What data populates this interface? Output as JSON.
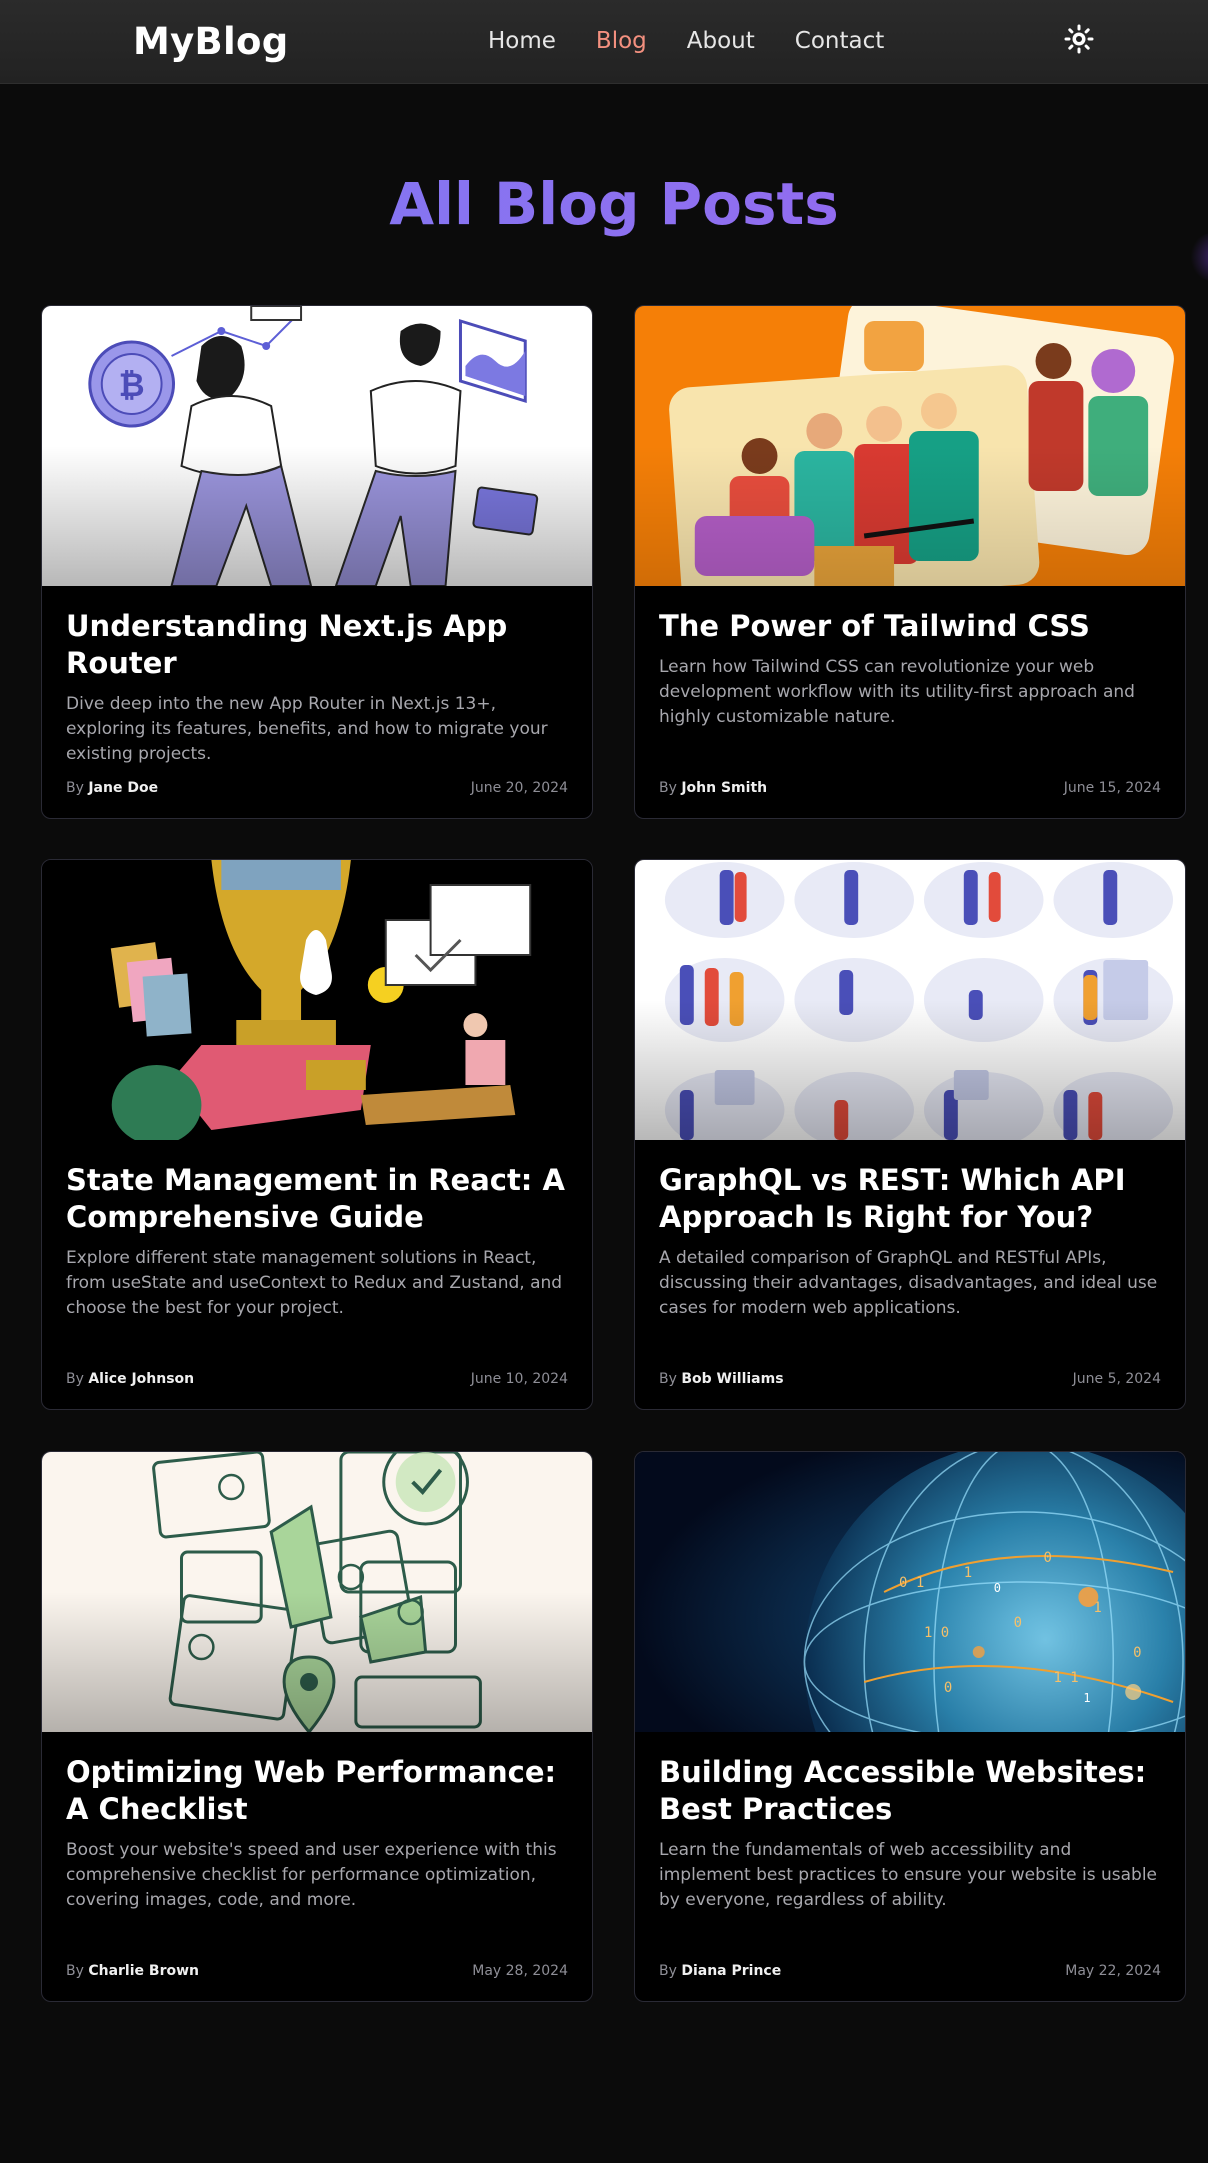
{
  "header": {
    "logo": "MyBlog",
    "nav": [
      "Home",
      "Blog",
      "About",
      "Contact"
    ],
    "active_nav": "Blog",
    "theme_icon": "sun-icon"
  },
  "page": {
    "title": "All Blog Posts"
  },
  "posts": [
    {
      "title": "Understanding Next.js App Router",
      "description": "Dive deep into the new App Router in Next.js 13+, exploring its features, benefits, and how to migrate your existing projects.",
      "by": "By",
      "author": "Jane Doe",
      "date": "June 20, 2024"
    },
    {
      "title": "The Power of Tailwind CSS",
      "description": "Learn how Tailwind CSS can revolutionize your web development workflow with its utility-first approach and highly customizable nature.",
      "by": "By",
      "author": "John Smith",
      "date": "June 15, 2024"
    },
    {
      "title": "State Management in React: A Comprehensive Guide",
      "description": "Explore different state management solutions in React, from useState and useContext to Redux and Zustand, and choose the best for your project.",
      "by": "By",
      "author": "Alice Johnson",
      "date": "June 10, 2024"
    },
    {
      "title": "GraphQL vs REST: Which API Approach Is Right for You?",
      "description": "A detailed comparison of GraphQL and RESTful APIs, discussing their advantages, disadvantages, and ideal use cases for modern web applications.",
      "by": "By",
      "author": "Bob Williams",
      "date": "June 5, 2024"
    },
    {
      "title": "Optimizing Web Performance: A Checklist",
      "description": "Boost your website's speed and user experience with this comprehensive checklist for performance optimization, covering images, code, and more.",
      "by": "By",
      "author": "Charlie Brown",
      "date": "May 28, 2024"
    },
    {
      "title": "Building Accessible Websites: Best Practices",
      "description": "Learn the fundamentals of web accessibility and implement best practices to ensure your website is usable by everyone, regardless of ability.",
      "by": "By",
      "author": "Diana Prince",
      "date": "May 22, 2024"
    }
  ],
  "colors": {
    "background": "#0b0b0b",
    "active_nav": "#f3907f",
    "title_gradient_start": "#7b7bf2",
    "title_gradient_end": "#9b5ef0",
    "card_border": "#2a2a35"
  }
}
